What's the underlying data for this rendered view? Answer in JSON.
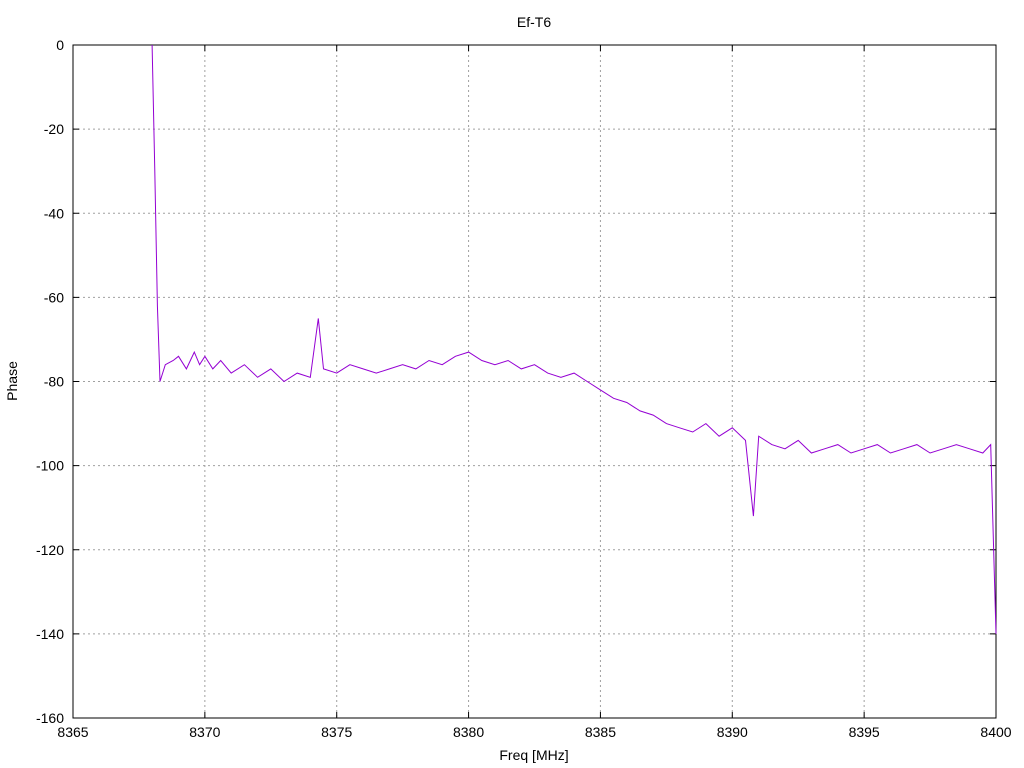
{
  "chart_data": {
    "type": "line",
    "title": "Ef-T6",
    "xlabel": "Freq [MHz]",
    "ylabel": "Phase",
    "xlim": [
      8365,
      8400
    ],
    "ylim": [
      -160,
      0
    ],
    "x_ticks": [
      8365,
      8370,
      8375,
      8380,
      8385,
      8390,
      8395,
      8400
    ],
    "y_ticks": [
      0,
      -20,
      -40,
      -60,
      -80,
      -100,
      -120,
      -140,
      -160
    ],
    "grid": true,
    "line_color": "#9400d3",
    "series": [
      {
        "x": [
          8368.0,
          8368.1,
          8368.2,
          8368.3,
          8368.5,
          8368.8,
          8369.0,
          8369.3,
          8369.6,
          8369.8,
          8370.0,
          8370.3,
          8370.6,
          8371.0,
          8371.5,
          8372.0,
          8372.5,
          8373.0,
          8373.5,
          8374.0,
          8374.3,
          8374.5,
          8375.0,
          8375.5,
          8376.0,
          8376.5,
          8377.0,
          8377.5,
          8378.0,
          8378.5,
          8379.0,
          8379.5,
          8380.0,
          8380.5,
          8381.0,
          8381.5,
          8382.0,
          8382.5,
          8383.0,
          8383.5,
          8384.0,
          8384.5,
          8385.0,
          8385.5,
          8386.0,
          8386.5,
          8387.0,
          8387.5,
          8388.0,
          8388.5,
          8389.0,
          8389.5,
          8390.0,
          8390.5,
          8390.8,
          8391.0,
          8391.5,
          8392.0,
          8392.5,
          8393.0,
          8393.5,
          8394.0,
          8394.5,
          8395.0,
          8395.5,
          8396.0,
          8396.5,
          8397.0,
          8397.5,
          8398.0,
          8398.5,
          8399.0,
          8399.5,
          8399.8,
          8400.0
        ],
        "y": [
          0,
          -30,
          -62,
          -80,
          -76,
          -75,
          -74,
          -77,
          -73,
          -76,
          -74,
          -77,
          -75,
          -78,
          -76,
          -79,
          -77,
          -80,
          -78,
          -79,
          -65,
          -77,
          -78,
          -76,
          -77,
          -78,
          -77,
          -76,
          -77,
          -75,
          -76,
          -74,
          -73,
          -75,
          -76,
          -75,
          -77,
          -76,
          -78,
          -79,
          -78,
          -80,
          -82,
          -84,
          -85,
          -87,
          -88,
          -90,
          -91,
          -92,
          -90,
          -93,
          -91,
          -94,
          -112,
          -93,
          -95,
          -96,
          -94,
          -97,
          -96,
          -95,
          -97,
          -96,
          -95,
          -97,
          -96,
          -95,
          -97,
          -96,
          -95,
          -96,
          -97,
          -95,
          -140
        ]
      }
    ]
  }
}
